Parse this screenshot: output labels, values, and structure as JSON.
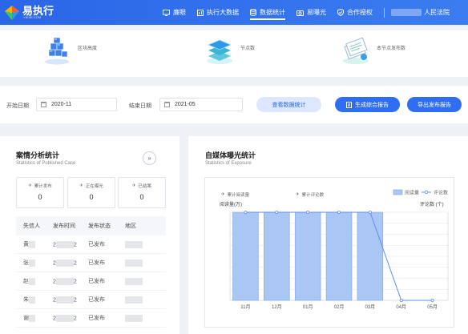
{
  "header": {
    "logo_text": "易执行",
    "logo_sub": "YIEXE.COM",
    "nav": [
      {
        "label": "廉眼",
        "icon": "screen-icon"
      },
      {
        "label": "执行大数据",
        "icon": "bigdata-icon"
      },
      {
        "label": "数据统计",
        "icon": "database-icon",
        "active": true
      },
      {
        "label": "易曝光",
        "icon": "camera-icon"
      },
      {
        "label": "合作授权",
        "icon": "shield-icon"
      }
    ],
    "user_suffix": "人民法院"
  },
  "stats": [
    {
      "label": "区块高度",
      "icon": "blocks-icon"
    },
    {
      "label": "节点数",
      "icon": "layers-icon"
    },
    {
      "label": "本节点发布数",
      "icon": "documents-icon"
    }
  ],
  "filter": {
    "start_label": "开始日期",
    "start_value": "2020-11",
    "end_label": "结束日期",
    "end_value": "2021-05",
    "view_button": "查看数据统计",
    "report_button": "生成综合报告",
    "export_button": "导出发布报告"
  },
  "case_stats": {
    "title": "案情分析统计",
    "subtitle": "Statistics of Published Case",
    "boxes": [
      {
        "label": "累计发布",
        "value": "0"
      },
      {
        "label": "正在曝光",
        "value": "0"
      },
      {
        "label": "已结案",
        "value": "0"
      }
    ],
    "columns": [
      "失信人",
      "发布时间",
      "发布状态",
      "地区"
    ],
    "rows": [
      {
        "name": "黄",
        "time_start": "2",
        "time_end": "2",
        "status": "已发布"
      },
      {
        "name": "张",
        "time_start": "2",
        "time_end": "2",
        "status": "已发布"
      },
      {
        "name": "赵",
        "time_start": "2",
        "time_end": "2",
        "status": "已发布"
      },
      {
        "name": "朱",
        "time_start": "2",
        "time_end": "2",
        "status": "已发布"
      },
      {
        "name": "谢",
        "time_start": "2",
        "time_end": "2",
        "status": "已发布"
      }
    ]
  },
  "exposure": {
    "title": "自媒体曝光统计",
    "subtitle": "Statistics of Exposure",
    "metric1": "累计阅读量",
    "metric2": "累计评论数"
  },
  "chart_data": {
    "type": "bar",
    "categories": [
      "11月",
      "12月",
      "01月",
      "02月",
      "03月",
      "04月",
      "05月"
    ],
    "series": [
      {
        "name": "阅读量",
        "type": "bar",
        "values": [
          1,
          1,
          1,
          1,
          1,
          0,
          0
        ]
      },
      {
        "name": "评论数",
        "type": "line",
        "values": [
          1,
          1,
          1,
          1,
          1,
          0,
          0
        ]
      }
    ],
    "ylabel_left": "阅读量(万)",
    "ylabel_right": "评论数 (个)",
    "colors": {
      "bar": "#a9c6f4",
      "bar_border": "#7aa5ec",
      "line": "#5b8ff0"
    },
    "grid": true,
    "legend_position": "top-right"
  }
}
